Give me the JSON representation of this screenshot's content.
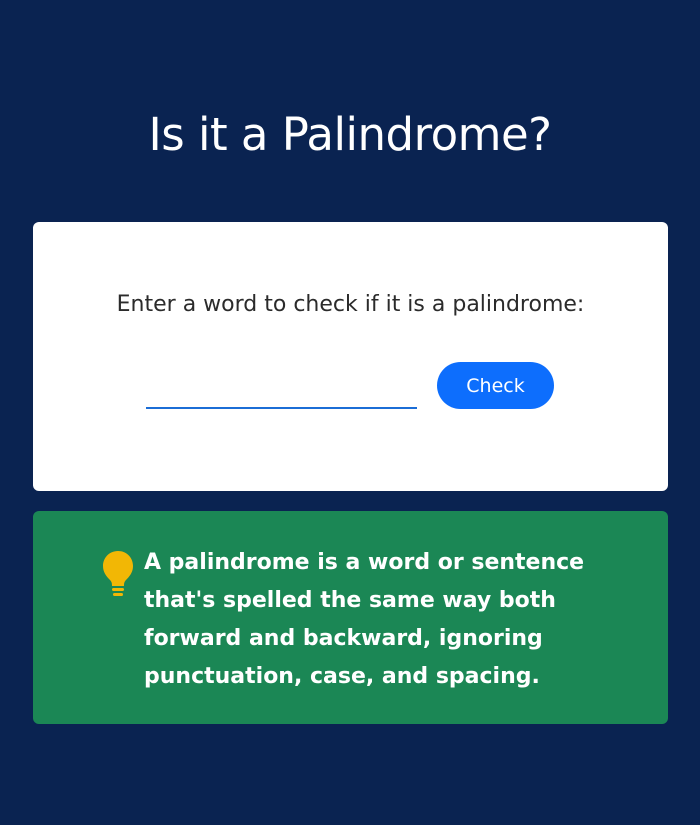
{
  "page": {
    "title": "Is it a Palindrome?"
  },
  "checker": {
    "prompt": "Enter a word to check if it is a palindrome:",
    "input_value": "",
    "input_placeholder": "",
    "button_label": "Check"
  },
  "info": {
    "icon": "lightbulb-icon",
    "text": "A palindrome is a word or sentence that's spelled the same way both forward and backward, ignoring punctuation, case, and spacing."
  },
  "colors": {
    "background": "#0a2351",
    "card": "#ffffff",
    "accent": "#0d6efd",
    "input_underline": "#1b6dd6",
    "info_background": "#1b8755",
    "bulb": "#f2b705"
  }
}
